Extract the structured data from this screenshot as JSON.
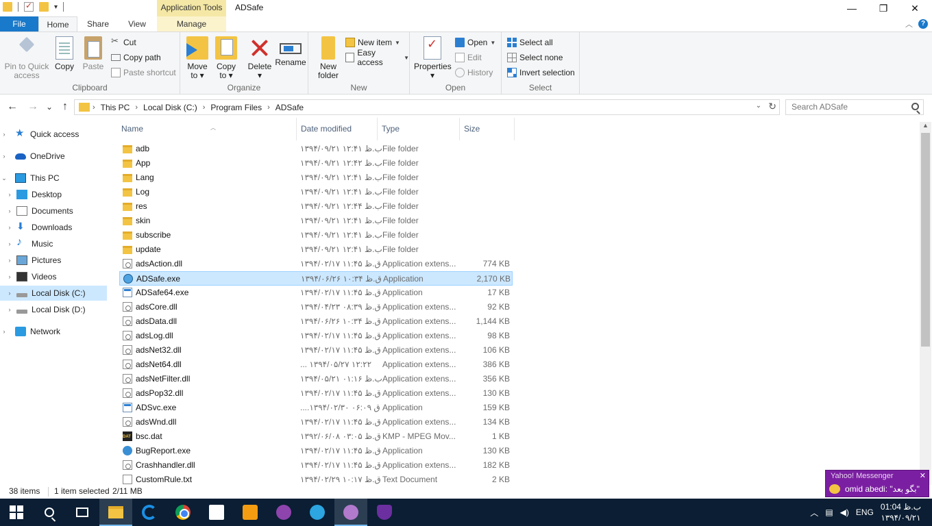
{
  "title_bar": {
    "context_tab_title": "Application Tools",
    "window_title": "ADSafe",
    "minimize": "—",
    "maximize": "❐",
    "close": "✕"
  },
  "ribbon_tabs": {
    "file": "File",
    "home": "Home",
    "share": "Share",
    "view": "View",
    "manage": "Manage",
    "collapse": "︿",
    "help": "?"
  },
  "ribbon": {
    "clipboard": {
      "label": "Clipboard",
      "pin_line1": "Pin to Quick",
      "pin_line2": "access",
      "copy": "Copy",
      "paste": "Paste",
      "cut": "Cut",
      "copy_path": "Copy path",
      "paste_shortcut": "Paste shortcut"
    },
    "organize": {
      "label": "Organize",
      "move_line1": "Move",
      "move_line2": "to ▾",
      "copy_line1": "Copy",
      "copy_line2": "to ▾",
      "delete_line1": "Delete",
      "delete_line2": "▾",
      "rename": "Rename"
    },
    "new": {
      "label": "New",
      "new_folder_line1": "New",
      "new_folder_line2": "folder",
      "new_item": "New item",
      "easy_access": "Easy access"
    },
    "open": {
      "label": "Open",
      "properties_line1": "Properties",
      "properties_line2": "▾",
      "open": "Open",
      "edit": "Edit",
      "history": "History"
    },
    "select": {
      "label": "Select",
      "select_all": "Select all",
      "select_none": "Select none",
      "invert_selection": "Invert selection"
    }
  },
  "address_bar": {
    "back": "←",
    "forward": "→",
    "recent": "⌄",
    "up": "↑",
    "crumbs": [
      "This PC",
      "Local Disk (C:)",
      "Program Files",
      "ADSafe"
    ],
    "crumb_sep": "›",
    "dropdown": "⌄",
    "refresh": "↻",
    "search_placeholder": "Search ADSafe"
  },
  "nav_pane": {
    "items": [
      {
        "label": "Quick access",
        "chev": "›"
      },
      {
        "label": "OneDrive",
        "chev": "›"
      },
      {
        "label": "This PC",
        "chev": "⌄"
      },
      {
        "label": "Desktop",
        "chev": "›"
      },
      {
        "label": "Documents",
        "chev": "›"
      },
      {
        "label": "Downloads",
        "chev": "›"
      },
      {
        "label": "Music",
        "chev": "›"
      },
      {
        "label": "Pictures",
        "chev": "›"
      },
      {
        "label": "Videos",
        "chev": "›"
      },
      {
        "label": "Local Disk (C:)",
        "chev": "›"
      },
      {
        "label": "Local Disk (D:)",
        "chev": "›"
      },
      {
        "label": "Network",
        "chev": "›"
      }
    ]
  },
  "file_list": {
    "columns": {
      "name": "Name",
      "date": "Date modified",
      "type": "Type",
      "size": "Size"
    },
    "rows": [
      {
        "name": "adb",
        "date": "۱۳۹۴/۰۹/۲۱ ب.ظ ۱۲:۴۱",
        "type": "File folder",
        "size": ""
      },
      {
        "name": "App",
        "date": "۱۳۹۴/۰۹/۲۱ ب.ظ ۱۲:۴۲",
        "type": "File folder",
        "size": ""
      },
      {
        "name": "Lang",
        "date": "۱۳۹۴/۰۹/۲۱ ب.ظ ۱۲:۴۱",
        "type": "File folder",
        "size": ""
      },
      {
        "name": "Log",
        "date": "۱۳۹۴/۰۹/۲۱ ب.ظ ۱۲:۴۱",
        "type": "File folder",
        "size": ""
      },
      {
        "name": "res",
        "date": "۱۳۹۴/۰۹/۲۱ ب.ظ ۱۲:۴۴",
        "type": "File folder",
        "size": ""
      },
      {
        "name": "skin",
        "date": "۱۳۹۴/۰۹/۲۱ ب.ظ ۱۲:۴۱",
        "type": "File folder",
        "size": ""
      },
      {
        "name": "subscribe",
        "date": "۱۳۹۴/۰۹/۲۱ ب.ظ ۱۲:۴۱",
        "type": "File folder",
        "size": ""
      },
      {
        "name": "update",
        "date": "۱۳۹۴/۰۹/۲۱ ب.ظ ۱۲:۴۱",
        "type": "File folder",
        "size": ""
      },
      {
        "name": "adsAction.dll",
        "date": "۱۳۹۴/۰۲/۱۷ ق.ظ ۱۱:۴۵",
        "type": "Application extens...",
        "size": "774 KB"
      },
      {
        "name": "ADSafe.exe",
        "date": "۱۳۹۴/۰۶/۲۶ ق.ظ ۱۰:۳۴",
        "type": "Application",
        "size": "2,170 KB"
      },
      {
        "name": "ADSafe64.exe",
        "date": "۱۳۹۴/۰۲/۱۷ ق.ظ ۱۱:۴۵",
        "type": "Application",
        "size": "17 KB"
      },
      {
        "name": "adsCore.dll",
        "date": "۱۳۹۴/۰۴/۲۳ ق.ظ ۰۸:۳۹",
        "type": "Application extens...",
        "size": "92 KB"
      },
      {
        "name": "adsData.dll",
        "date": "۱۳۹۴/۰۶/۲۶ ق.ظ ۱۰:۳۴",
        "type": "Application extens...",
        "size": "1,144 KB"
      },
      {
        "name": "adsLog.dll",
        "date": "۱۳۹۴/۰۲/۱۷ ق.ظ ۱۱:۴۵",
        "type": "Application extens...",
        "size": "98 KB"
      },
      {
        "name": "adsNet32.dll",
        "date": "۱۳۹۴/۰۲/۱۷ ق.ظ ۱۱:۴۵",
        "type": "Application extens...",
        "size": "106 KB"
      },
      {
        "name": "adsNet64.dll",
        "date": "... ۱۳۹۴/۰۵/۲۷ ۱۲:۲۲",
        "type": "Application extens...",
        "size": "386 KB"
      },
      {
        "name": "adsNetFilter.dll",
        "date": "۱۳۹۴/۰۵/۲۱ ب.ظ ۰۱:۱۶",
        "type": "Application extens...",
        "size": "356 KB"
      },
      {
        "name": "adsPop32.dll",
        "date": "۱۳۹۴/۰۲/۱۷ ق.ظ ۱۱:۴۵",
        "type": "Application extens...",
        "size": "130 KB"
      },
      {
        "name": "ADSvc.exe",
        "date": "....۱۳۹۴/۰۲/۳۰ ق ۰۶:۰۹",
        "type": "Application",
        "size": "159 KB"
      },
      {
        "name": "adsWnd.dll",
        "date": "۱۳۹۴/۰۲/۱۷ ق.ظ ۱۱:۴۵",
        "type": "Application extens...",
        "size": "134 KB"
      },
      {
        "name": "bsc.dat",
        "date": "۱۳۹۲/۰۶/۰۸ ق.ظ ۰۳:۰۵",
        "type": "KMP - MPEG Mov...",
        "size": "1 KB"
      },
      {
        "name": "BugReport.exe",
        "date": "۱۳۹۴/۰۲/۱۷ ق.ظ ۱۱:۴۵",
        "type": "Application",
        "size": "130 KB"
      },
      {
        "name": "Crashhandler.dll",
        "date": "۱۳۹۴/۰۲/۱۷ ق.ظ ۱۱:۴۵",
        "type": "Application extens...",
        "size": "182 KB"
      },
      {
        "name": "CustomRule.txt",
        "date": "۱۳۹۴/۰۲/۲۹ ق.ظ ۱۰:۱۷",
        "type": "Text Document",
        "size": "2 KB"
      }
    ]
  },
  "status_bar": {
    "items_count": "38 items",
    "selected": "1 item selected",
    "size": "2/11 MB"
  },
  "notification": {
    "title": "Yahoo! Messenger",
    "close": "✕",
    "message": "omid abedi: \"بگو بعد\""
  },
  "taskbar": {
    "tray_caret": "︿",
    "tray_lang": "ENG",
    "clock_time": "ب.ظ 01:04",
    "clock_date": "۱۳۹۴/۰۹/۲۱"
  }
}
